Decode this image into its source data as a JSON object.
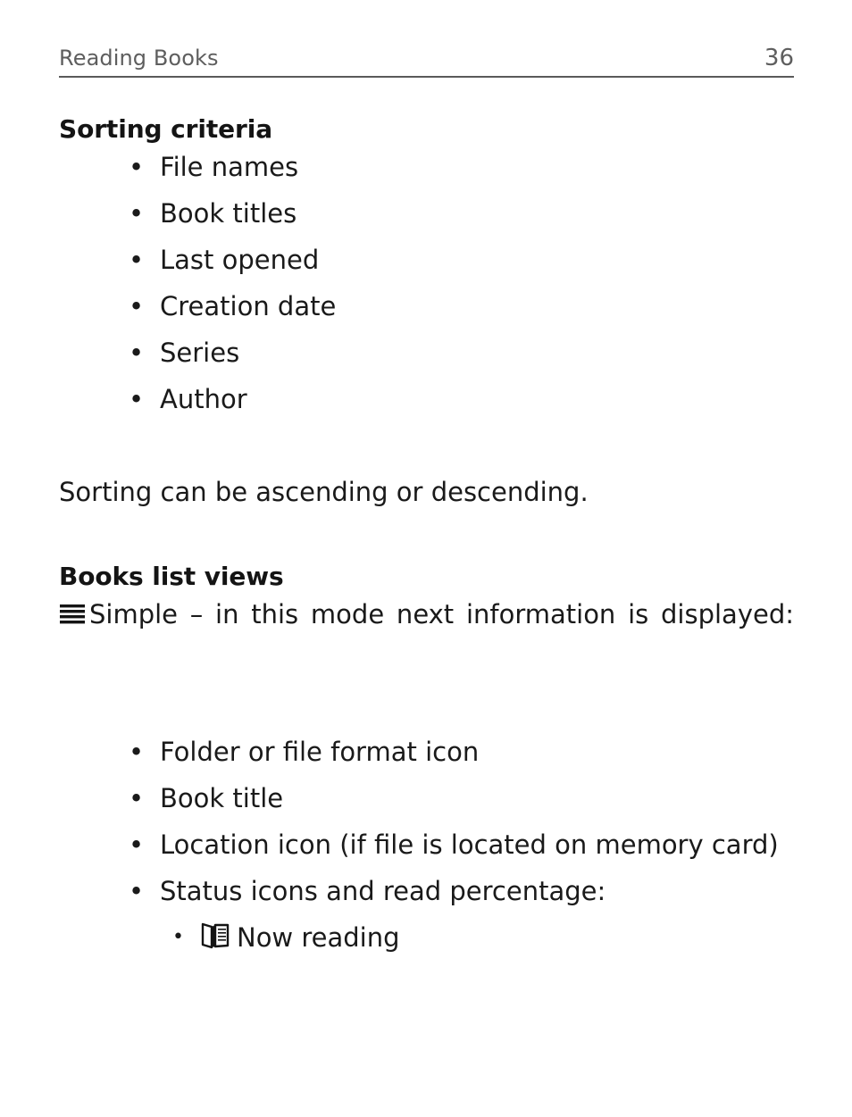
{
  "header": {
    "title": "Reading Books",
    "page_number": "36",
    "rule_color": "#5a5a5a",
    "text_color": "#5e5e5e"
  },
  "content": {
    "heading_sorting": "Sorting criteria",
    "sorting_criteria": [
      "File names",
      "Book titles",
      "Last opened",
      "Creation date",
      "Series",
      "Author"
    ],
    "sorting_note": "Sorting can be ascending or descending.",
    "heading_views": "Books list views",
    "simple_view": {
      "icon": "hamburger-list-icon",
      "text": "Simple – in this mode next information is displayed:"
    },
    "simple_items": [
      "Folder or file format icon",
      "Book title"
    ],
    "location_item": "Location icon (if file is located on memory card)",
    "status_item": "Status icons and read percentage:",
    "status_sub_items": [
      {
        "icon": "open-book-icon",
        "label": "Now reading"
      }
    ]
  },
  "colors": {
    "page_background": "#ffffff",
    "body_text": "#1a1a1a",
    "header_text": "#5e5e5e"
  }
}
